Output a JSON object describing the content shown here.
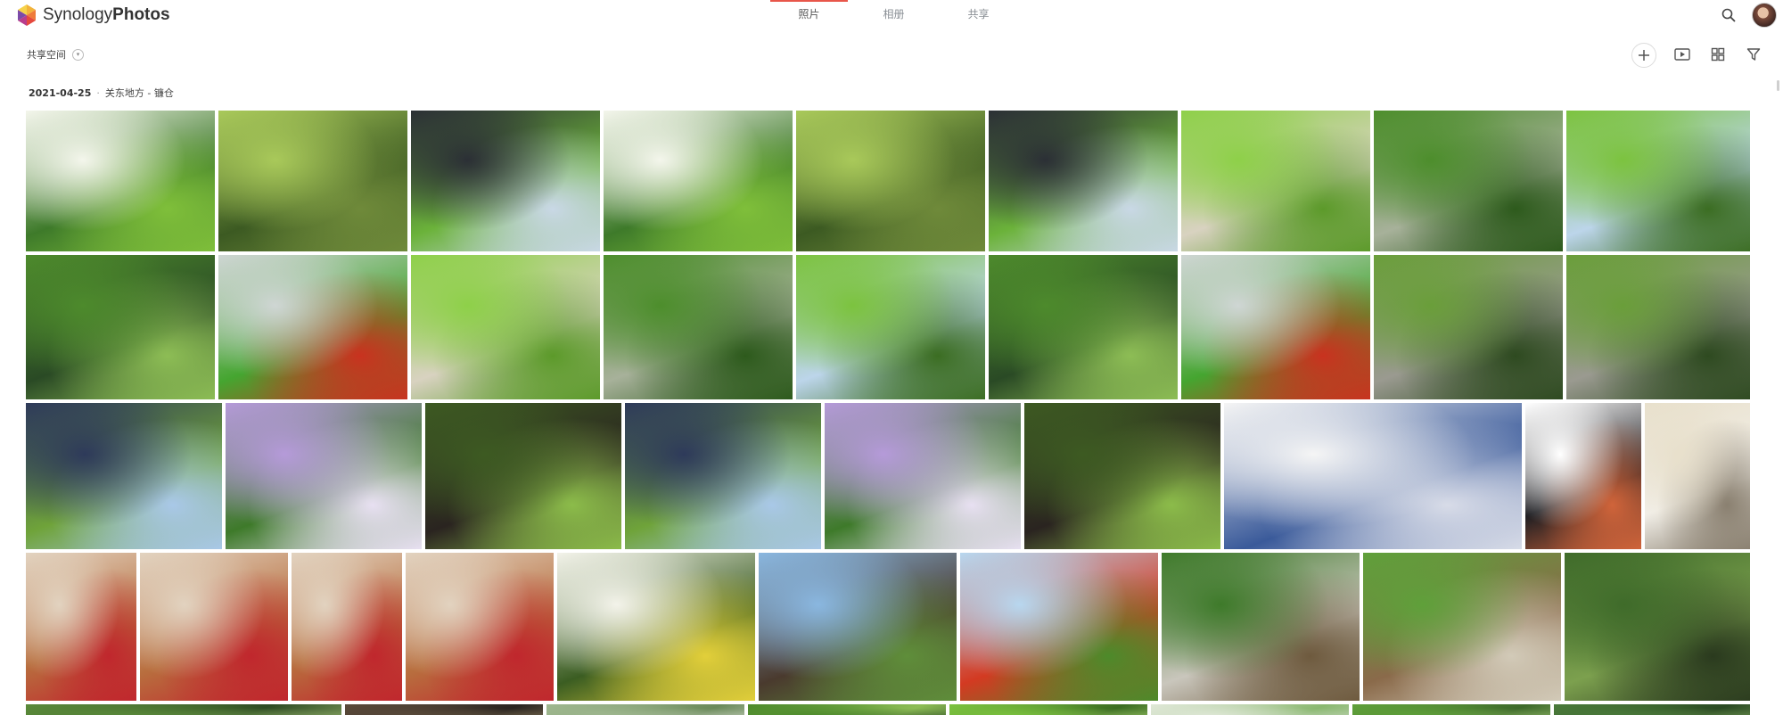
{
  "app": {
    "brand_light": "Synology",
    "brand_bold": "Photos"
  },
  "nav": {
    "tabs": [
      {
        "label": "照片",
        "active": true
      },
      {
        "label": "相册",
        "active": false
      },
      {
        "label": "共享",
        "active": false
      }
    ]
  },
  "toolbar": {
    "space_label": "共享空间",
    "icons": [
      "add-icon",
      "slideshow-icon",
      "grid-view-icon",
      "filter-icon"
    ]
  },
  "header": {
    "date": "2021-04-25",
    "location": "关东地方 - 镰仓"
  },
  "colors": {
    "accent": "#e8564a",
    "text": "#333333",
    "muted": "#8a8f95"
  },
  "photos": [
    {
      "subject": "white hydrangea flowers",
      "colors": [
        "#f4f6ec",
        "#3e7a2a",
        "#7fbf3a"
      ]
    },
    {
      "subject": "garden path with lantern",
      "colors": [
        "#a9c95a",
        "#3c5a22",
        "#6f8a3a"
      ]
    },
    {
      "subject": "temple gate",
      "colors": [
        "#2b2f35",
        "#6bb23a",
        "#c9d8e6"
      ]
    },
    {
      "subject": "white hydrangea flowers",
      "colors": [
        "#f4f6ec",
        "#3e7a2a",
        "#7fbf3a"
      ]
    },
    {
      "subject": "garden path with lantern",
      "colors": [
        "#a9c95a",
        "#3c5a22",
        "#6f8a3a"
      ]
    },
    {
      "subject": "temple gate",
      "colors": [
        "#2b2f35",
        "#6bb23a",
        "#c9d8e6"
      ]
    },
    {
      "subject": "green garden with gravel",
      "colors": [
        "#8ed049",
        "#d8d2c0",
        "#5c9a2a"
      ]
    },
    {
      "subject": "stone steps in garden",
      "colors": [
        "#4d8e2c",
        "#a7b19a",
        "#2d5a1c"
      ]
    },
    {
      "subject": "maple tree and house",
      "colors": [
        "#7cc33f",
        "#bcd5ea",
        "#3b6d22"
      ]
    },
    {
      "subject": "garden pond with stones",
      "colors": [
        "#4d8a2c",
        "#2a4a25",
        "#8dbd55"
      ]
    },
    {
      "subject": "leaves and red fish",
      "colors": [
        "#cfd6d4",
        "#45a530",
        "#c9321f"
      ]
    },
    {
      "subject": "green garden with gravel",
      "colors": [
        "#8ed049",
        "#d8d2c0",
        "#5c9a2a"
      ]
    },
    {
      "subject": "stone steps in garden",
      "colors": [
        "#4d8e2c",
        "#a7b19a",
        "#2d5a1c"
      ]
    },
    {
      "subject": "maple tree and house",
      "colors": [
        "#7cc33f",
        "#bcd5ea",
        "#3b6d22"
      ]
    },
    {
      "subject": "garden pond with stones",
      "colors": [
        "#4d8a2c",
        "#2a4a25",
        "#8dbd55"
      ]
    },
    {
      "subject": "leaves and red fish",
      "colors": [
        "#cfd6d4",
        "#45a530",
        "#c9321f"
      ]
    },
    {
      "subject": "temple gate and stairs",
      "colors": [
        "#6a9e3a",
        "#9a9a90",
        "#2e4a20"
      ]
    },
    {
      "subject": "temple gate and stairs",
      "colors": [
        "#6a9e3a",
        "#9a9a90",
        "#2e4a20"
      ]
    },
    {
      "subject": "temple hall and pond",
      "colors": [
        "#2e3a5a",
        "#6fa33a",
        "#a9c8e8"
      ]
    },
    {
      "subject": "purple daisies",
      "colors": [
        "#b59ad9",
        "#3e7a2a",
        "#e8e0f2"
      ]
    },
    {
      "subject": "small shrine",
      "colors": [
        "#3d5a22",
        "#2a2420",
        "#8cbc4a"
      ]
    },
    {
      "subject": "temple hall and pond",
      "colors": [
        "#2e3a5a",
        "#6fa33a",
        "#a9c8e8"
      ]
    },
    {
      "subject": "purple daisies",
      "colors": [
        "#b59ad9",
        "#3e7a2a",
        "#e8e0f2"
      ]
    },
    {
      "subject": "small shrine",
      "colors": [
        "#3d5a22",
        "#2a2420",
        "#8cbc4a"
      ]
    },
    {
      "subject": "video page screenshot",
      "colors": [
        "#f5f5f5",
        "#3a5a9a",
        "#d8dce8"
      ]
    },
    {
      "subject": "black server tower",
      "colors": [
        "#ffffff",
        "#1e1e22",
        "#d0643a"
      ]
    },
    {
      "subject": "menu board sign",
      "colors": [
        "#e8e0cc",
        "#f2efe8",
        "#8a8070"
      ]
    },
    {
      "subject": "soft serve ice cream",
      "colors": [
        "#e2d3c0",
        "#b86e3e",
        "#c0272d"
      ]
    },
    {
      "subject": "soft serve ice cream",
      "colors": [
        "#e2d3c0",
        "#b86e3e",
        "#c0272d"
      ]
    },
    {
      "subject": "soft serve ice cream",
      "colors": [
        "#e2d3c0",
        "#b86e3e",
        "#c0272d"
      ]
    },
    {
      "subject": "soft serve ice cream",
      "colors": [
        "#e2d3c0",
        "#b86e3e",
        "#c0272d"
      ]
    },
    {
      "subject": "white and yellow daisies",
      "colors": [
        "#f3f3ea",
        "#3b5d22",
        "#e2cf3a"
      ]
    },
    {
      "subject": "temple entrance",
      "colors": [
        "#8ab7e0",
        "#4a3a2e",
        "#5f8e3a"
      ]
    },
    {
      "subject": "red maple tree",
      "colors": [
        "#b8d7ef",
        "#d33a22",
        "#4d8a2a"
      ]
    },
    {
      "subject": "bamboo forest path",
      "colors": [
        "#3e7a2a",
        "#c9c6bc",
        "#6e5a3e"
      ]
    },
    {
      "subject": "wooden pavilion",
      "colors": [
        "#5fa03a",
        "#8a6a4a",
        "#d2cab8"
      ]
    },
    {
      "subject": "bamboo grove",
      "colors": [
        "#3f6b2a",
        "#7ca04e",
        "#2a3a1e"
      ]
    },
    {
      "subject": "bamboo grove",
      "colors": [
        "#5a8a3a",
        "#2d4a22",
        "#9ab870"
      ]
    },
    {
      "subject": "wooden eaves",
      "colors": [
        "#5a4a3a",
        "#2a2420",
        "#8a7a5a"
      ]
    },
    {
      "subject": "garden",
      "colors": [
        "#a0b890",
        "#6a8a5a",
        "#d0d8c8"
      ]
    },
    {
      "subject": "garden",
      "colors": [
        "#4d8a2c",
        "#8dbd55",
        "#2a4a25"
      ]
    },
    {
      "subject": "garden",
      "colors": [
        "#7cc33f",
        "#3b6d22",
        "#a8d070"
      ]
    },
    {
      "subject": "garden",
      "colors": [
        "#e0e8d8",
        "#8ab870",
        "#c8d8c0"
      ]
    },
    {
      "subject": "garden",
      "colors": [
        "#5fa03a",
        "#3e6a2a",
        "#9ac070"
      ]
    },
    {
      "subject": "garden",
      "colors": [
        "#4a7a3a",
        "#2a4a22",
        "#7aa05a"
      ]
    }
  ]
}
